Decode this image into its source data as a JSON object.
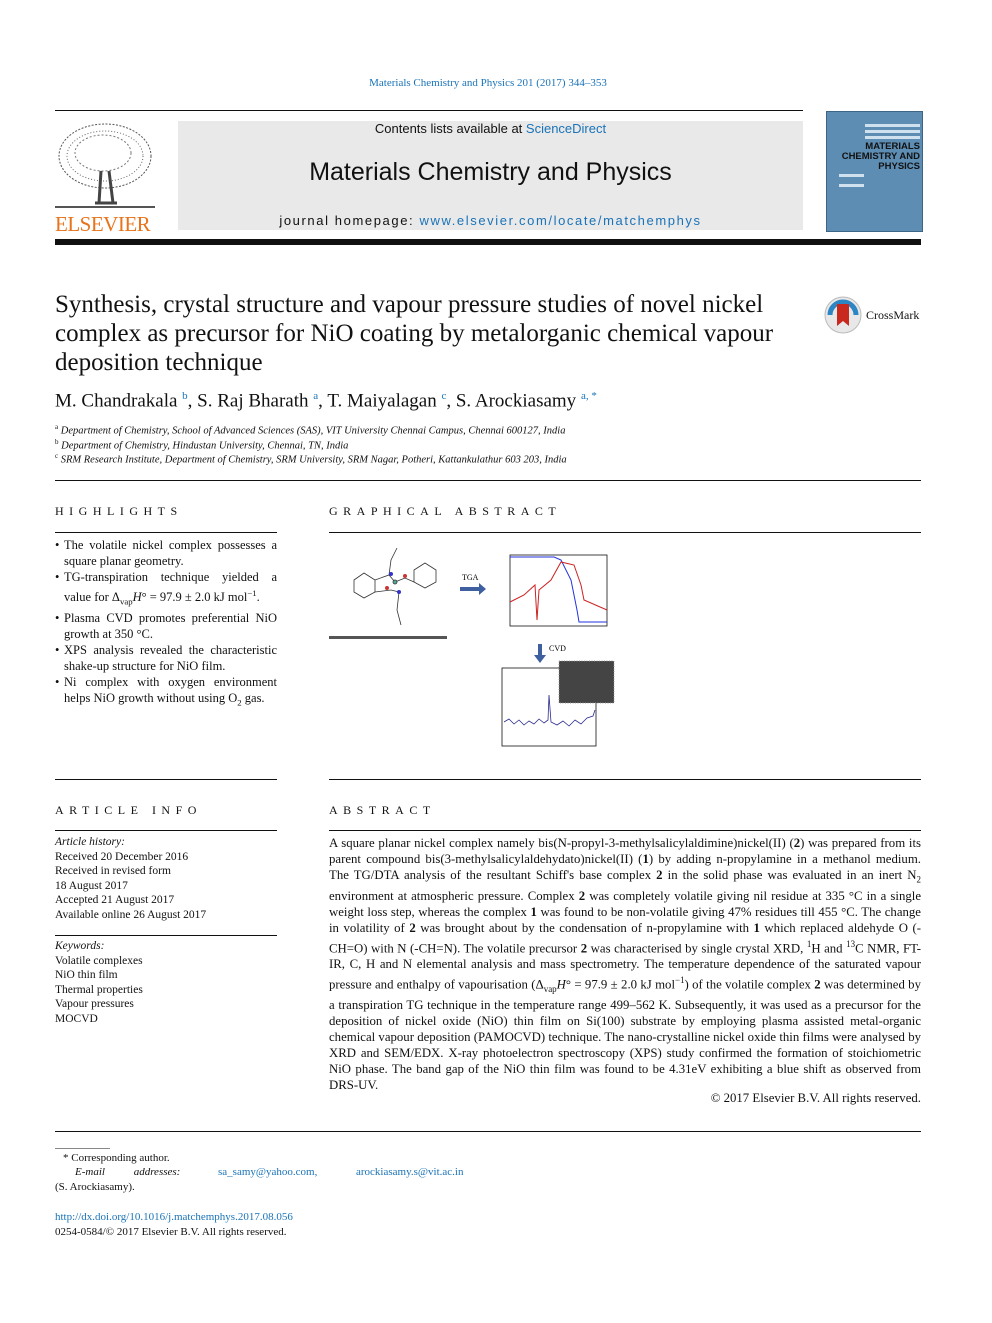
{
  "header": {
    "journal_ref": "Materials Chemistry and Physics 201 (2017) 344–353",
    "contents_prefix": "Contents lists available at ",
    "contents_link": "ScienceDirect",
    "journal_title": "Materials Chemistry and Physics",
    "homepage_prefix": "journal homepage: ",
    "homepage_link": "www.elsevier.com/locate/matchemphys",
    "publisher_logo_text": "ELSEVIER",
    "cover_text": "MATERIALS CHEMISTRY AND PHYSICS",
    "colors": {
      "link": "#1a73b8",
      "elsevier": "#e8731a",
      "cover": "#5d8db3",
      "banner": "#e9e9e9"
    }
  },
  "article": {
    "title": "Synthesis, crystal structure and vapour pressure studies of novel nickel complex as precursor for NiO coating by metalorganic chemical vapour deposition technique",
    "crossmark": "CrossMark",
    "authors": [
      {
        "name": "M. Chandrakala",
        "sup": "b"
      },
      {
        "name": "S. Raj Bharath",
        "sup": "a"
      },
      {
        "name": "T. Maiyalagan",
        "sup": "c"
      },
      {
        "name": "S. Arockiasamy",
        "sup": "a, *"
      }
    ],
    "affiliations": [
      {
        "sup": "a",
        "text": "Department of Chemistry, School of Advanced Sciences (SAS), VIT University Chennai Campus, Chennai 600127, India"
      },
      {
        "sup": "b",
        "text": "Department of Chemistry, Hindustan University, Chennai, TN, India"
      },
      {
        "sup": "c",
        "text": "SRM Research Institute, Department of Chemistry, SRM University, SRM Nagar, Potheri, Kattankulathur 603 203, India"
      }
    ]
  },
  "highlights": {
    "heading": "HIGHLIGHTS",
    "items": [
      [
        {
          "t": "The volatile nickel complex possesses a square planar geometry."
        }
      ],
      [
        {
          "t": "TG-transpiration technique yielded a value for Δ"
        },
        {
          "t": "vap",
          "s": "sub"
        },
        {
          "t": "H",
          "s": "i"
        },
        {
          "t": "° = 97.9 ± 2.0 kJ mol"
        },
        {
          "t": "−1",
          "s": "sup"
        },
        {
          "t": "."
        }
      ],
      [
        {
          "t": "Plasma CVD promotes preferential NiO growth at 350 °C."
        }
      ],
      [
        {
          "t": "XPS analysis revealed the characteristic shake-up structure for NiO film."
        }
      ],
      [
        {
          "t": "Ni complex with oxygen environment helps NiO growth without using O"
        },
        {
          "t": "2",
          "s": "sub"
        },
        {
          "t": " gas."
        }
      ]
    ]
  },
  "graphical_abstract": {
    "heading": "GRAPHICAL ABSTRACT",
    "arrow1_label": "TGA",
    "arrow2_label": "CVD"
  },
  "article_info": {
    "heading": "ARTICLE INFO",
    "history_label": "Article history:",
    "history": [
      "Received 20 December 2016",
      "Received in revised form",
      "18 August 2017",
      "Accepted 21 August 2017",
      "Available online 26 August 2017"
    ],
    "keywords_label": "Keywords:",
    "keywords": [
      "Volatile complexes",
      "NiO thin film",
      "Thermal properties",
      "Vapour pressures",
      "MOCVD"
    ]
  },
  "abstract": {
    "heading": "ABSTRACT",
    "segments": [
      {
        "t": "A square planar nickel complex namely bis(N-propyl-3-methylsalicylaldimine)nickel(II) ("
      },
      {
        "t": "2",
        "s": "b"
      },
      {
        "t": ") was prepared from its parent compound bis(3-methylsalicylaldehydato)nickel(II) ("
      },
      {
        "t": "1",
        "s": "b"
      },
      {
        "t": ") by adding n-propylamine in a methanol medium. The TG/DTA analysis of the resultant Schiff's base complex "
      },
      {
        "t": "2",
        "s": "b"
      },
      {
        "t": " in the solid phase was evaluated in an inert N"
      },
      {
        "t": "2",
        "s": "sub"
      },
      {
        "t": " environment at atmospheric pressure. Complex "
      },
      {
        "t": "2",
        "s": "b"
      },
      {
        "t": " was completely volatile giving nil residue at 335 °C in a single weight loss step, whereas the complex "
      },
      {
        "t": "1",
        "s": "b"
      },
      {
        "t": " was found to be non-volatile giving 47% residues till 455 °C. The change in volatility of "
      },
      {
        "t": "2",
        "s": "b"
      },
      {
        "t": " was brought about by the condensation of n-propylamine with "
      },
      {
        "t": "1",
        "s": "b"
      },
      {
        "t": " which replaced aldehyde O (-CH=O) with N (-CH=N). The volatile precursor "
      },
      {
        "t": "2",
        "s": "b"
      },
      {
        "t": " was characterised by single crystal XRD, "
      },
      {
        "t": "1",
        "s": "sup"
      },
      {
        "t": "H and "
      },
      {
        "t": "13",
        "s": "sup"
      },
      {
        "t": "C NMR, FT-IR, C, H and N elemental analysis and mass spectrometry. The temperature dependence of the saturated vapour pressure and enthalpy of vapourisation (Δ"
      },
      {
        "t": "vap",
        "s": "sub"
      },
      {
        "t": "H",
        "s": "i"
      },
      {
        "t": "° = 97.9 ± 2.0 kJ mol"
      },
      {
        "t": "−1",
        "s": "sup"
      },
      {
        "t": ") of the volatile complex "
      },
      {
        "t": "2",
        "s": "b"
      },
      {
        "t": " was determined by a transpiration TG technique in the temperature range 499–562 K. Subsequently, it was used as a precursor for the deposition of nickel oxide (NiO) thin film on Si(100) substrate by employing plasma assisted metal-organic chemical vapour deposition (PAMOCVD) technique. The nano-crystalline nickel oxide thin films were analysed by XRD and SEM/EDX. X-ray photoelectron spectroscopy (XPS) study confirmed the formation of stoichiometric NiO phase. The band gap of the NiO thin film was found to be 4.31eV exhibiting a blue shift as observed from DRS-UV."
      }
    ],
    "copyright": "© 2017 Elsevier B.V. All rights reserved."
  },
  "footer": {
    "corresponding": "* Corresponding author.",
    "email_label": "E-mail addresses:",
    "emails": [
      "sa_samy@yahoo.com,",
      "arockiasamy.s@vit.ac.in"
    ],
    "email_owner": "(S. Arockiasamy).",
    "doi": "http://dx.doi.org/10.1016/j.matchemphys.2017.08.056",
    "issn": "0254-0584/© 2017 Elsevier B.V. All rights reserved."
  }
}
